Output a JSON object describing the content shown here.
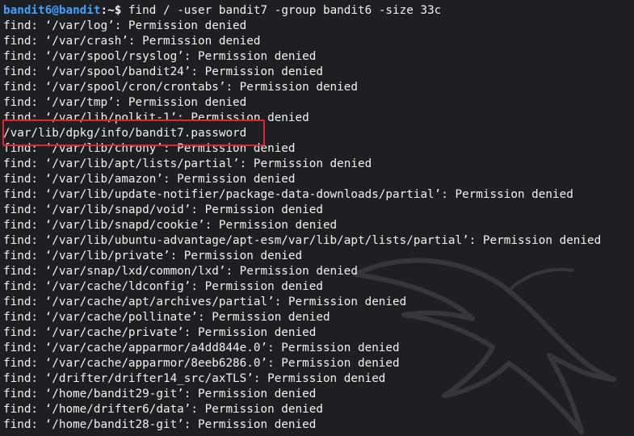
{
  "prompt": {
    "user_host": "bandit6@bandit",
    "separator": ":~$",
    "command": " find / -user bandit7 -group bandit6 -size 33c"
  },
  "output_lines": [
    "find: ‘/var/log’: Permission denied",
    "find: ‘/var/crash’: Permission denied",
    "find: ‘/var/spool/rsyslog’: Permission denied",
    "find: ‘/var/spool/bandit24’: Permission denied",
    "find: ‘/var/spool/cron/crontabs’: Permission denied",
    "find: ‘/var/tmp’: Permission denied",
    "find: ‘/var/lib/polkit-1’: Permission denied",
    "/var/lib/dpkg/info/bandit7.password",
    "find: ‘/var/lib/chrony’: Permission denied",
    "find: ‘/var/lib/apt/lists/partial’: Permission denied",
    "find: ‘/var/lib/amazon’: Permission denied",
    "find: ‘/var/lib/update-notifier/package-data-downloads/partial’: Permission denied",
    "find: ‘/var/lib/snapd/void’: Permission denied",
    "find: ‘/var/lib/snapd/cookie’: Permission denied",
    "find: ‘/var/lib/ubuntu-advantage/apt-esm/var/lib/apt/lists/partial’: Permission denied",
    "find: ‘/var/lib/private’: Permission denied",
    "find: ‘/var/snap/lxd/common/lxd’: Permission denied",
    "find: ‘/var/cache/ldconfig’: Permission denied",
    "find: ‘/var/cache/apt/archives/partial’: Permission denied",
    "find: ‘/var/cache/pollinate’: Permission denied",
    "find: ‘/var/cache/private’: Permission denied",
    "find: ‘/var/cache/apparmor/a4dd844e.0’: Permission denied",
    "find: ‘/var/cache/apparmor/8eeb6286.0’: Permission denied",
    "find: ‘/drifter/drifter14_src/axTLS’: Permission denied",
    "find: ‘/home/bandit29-git’: Permission denied",
    "find: ‘/home/drifter6/data’: Permission denied",
    "find: ‘/home/bandit28-git’: Permission denied"
  ],
  "colors": {
    "background": "#1d1f23",
    "text": "#f2f2f2",
    "prompt_user": "#3fa2ff",
    "highlight_border": "#e0262e"
  }
}
